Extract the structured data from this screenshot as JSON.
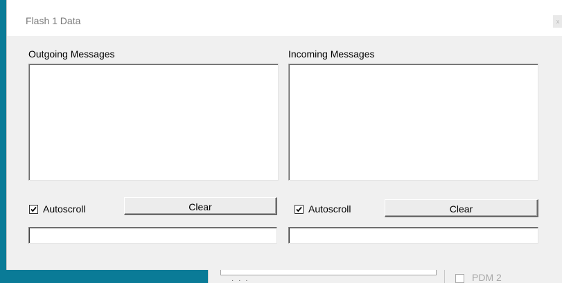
{
  "window": {
    "title": "Flash 1 Data",
    "close_glyph": "x"
  },
  "outgoing": {
    "label": "Outgoing Messages",
    "autoscroll_label": "Autoscroll",
    "autoscroll_checked": true,
    "clear_label": "Clear",
    "input_value": ""
  },
  "incoming": {
    "label": "Incoming Messages",
    "autoscroll_label": "Autoscroll",
    "autoscroll_checked": true,
    "clear_label": "Clear",
    "input_value": ""
  },
  "background": {
    "checkbox_label": "PDM 2",
    "ellipsis": "· · ·"
  },
  "colors": {
    "accent": "#0a7b97",
    "window_bg": "#f0f0f0"
  }
}
